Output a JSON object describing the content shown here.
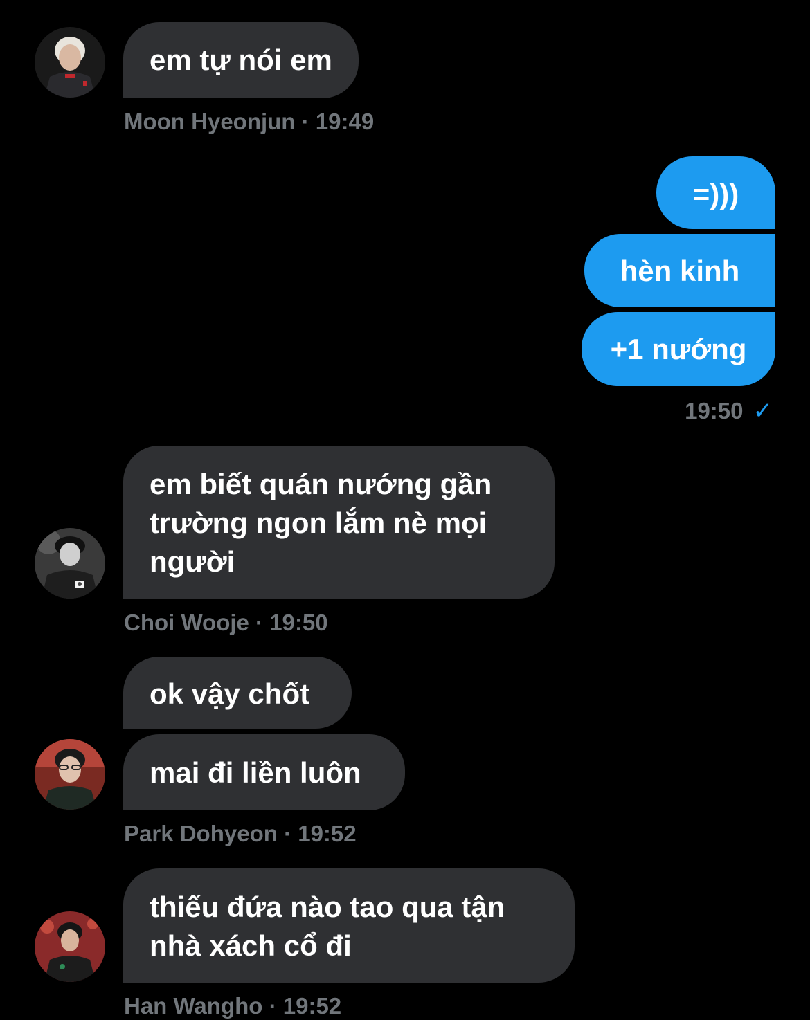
{
  "messages": [
    {
      "text": "em tự nói em"
    },
    {
      "meta": "Moon Hyeonjun · 19:49"
    },
    {
      "text": "=)))"
    },
    {
      "text": "hèn kinh"
    },
    {
      "text": "+1 nướng"
    },
    {
      "meta": "19:50"
    },
    {
      "text_lines": [
        "em biết quán nướng gần",
        "trường ngon lắm nè mọi",
        "người"
      ]
    },
    {
      "meta": "Choi Wooje · 19:50"
    },
    {
      "text": "ok vậy chốt"
    },
    {
      "text": "mai đi liền luôn"
    },
    {
      "meta": "Park Dohyeon · 19:52"
    },
    {
      "text_lines": [
        "thiếu đứa nào tao qua tận",
        "nhà xách cổ đi"
      ]
    },
    {
      "meta": "Han Wangho · 19:52"
    }
  ],
  "colors": {
    "background": "#000000",
    "incoming_bubble": "#2f3033",
    "outgoing_bubble": "#1d9bf0",
    "meta_text": "#71767b",
    "read_check": "#1d9bf0"
  },
  "icons": {
    "read_receipt": "check-icon"
  }
}
